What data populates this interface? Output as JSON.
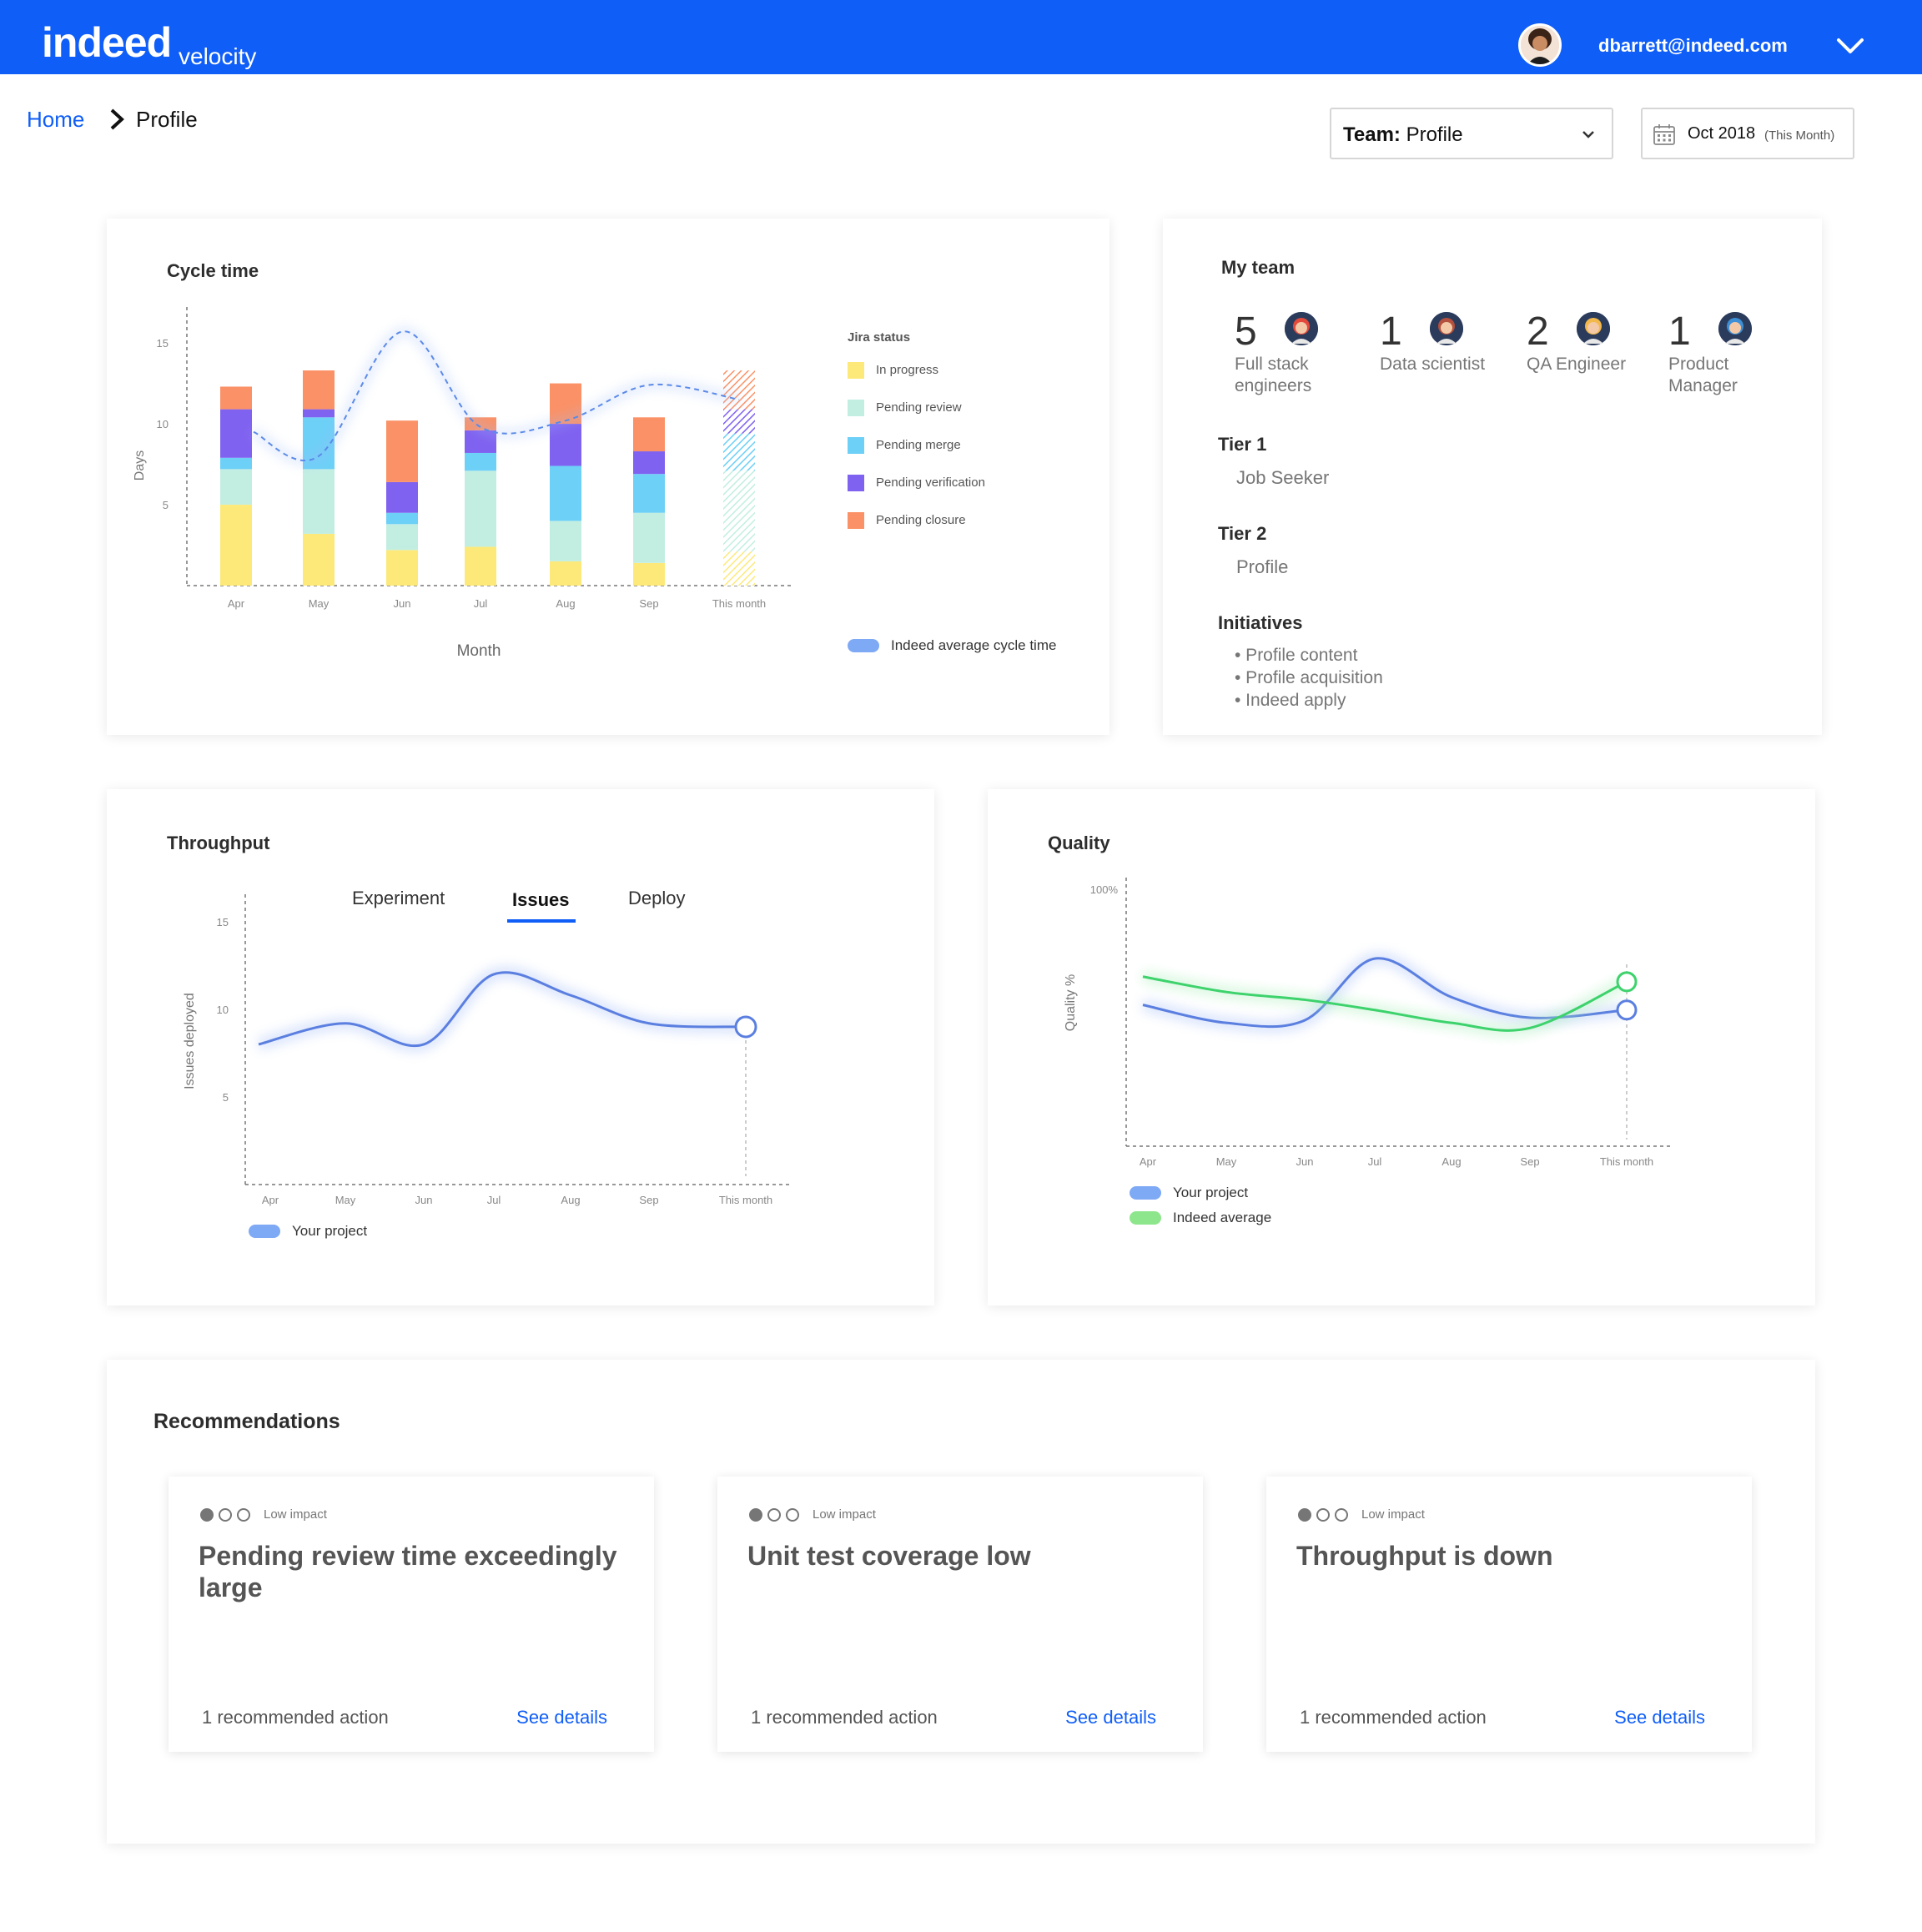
{
  "app": {
    "logo": "indeed",
    "logo_sub": "velocity",
    "user_email": "dbarrett@indeed.com"
  },
  "breadcrumb": {
    "home": "Home",
    "current": "Profile"
  },
  "filters": {
    "team_label": "Team:",
    "team_value": "Profile",
    "date_value": "Oct 2018",
    "date_note": "(This Month)"
  },
  "colors": {
    "brand": "#0f5ef7",
    "in_progress": "#fde97a",
    "pending_review": "#c2eee2",
    "pending_merge": "#6dd0f7",
    "pending_verification": "#8062f0",
    "pending_closure": "#fb9166",
    "your_project": "#5b7fe0",
    "indeed_average": "#3dd26c"
  },
  "cycle_time": {
    "title": "Cycle time",
    "legend_title": "Jira status",
    "legend": [
      {
        "label": "In progress",
        "color": "#fde97a"
      },
      {
        "label": "Pending review",
        "color": "#c2eee2"
      },
      {
        "label": "Pending merge",
        "color": "#6dd0f7"
      },
      {
        "label": "Pending verification",
        "color": "#8062f0"
      },
      {
        "label": "Pending closure",
        "color": "#fb9166"
      }
    ],
    "avg_legend": "Indeed average cycle time"
  },
  "my_team": {
    "title": "My team",
    "members": [
      {
        "count": "5",
        "role": "Full stack engineers",
        "avatar": "engineer-avatar-icon",
        "color": "#e44a3b"
      },
      {
        "count": "1",
        "role": "Data scientist",
        "avatar": "scientist-avatar-icon",
        "color": "#b4503d"
      },
      {
        "count": "2",
        "role": "QA Engineer",
        "avatar": "qa-avatar-icon",
        "color": "#f2b84a"
      },
      {
        "count": "1",
        "role": "Product Manager",
        "avatar": "pm-avatar-icon",
        "color": "#3d8fd6"
      }
    ],
    "tier1_label": "Tier 1",
    "tier1_value": "Job Seeker",
    "tier2_label": "Tier 2",
    "tier2_value": "Profile",
    "initiatives_label": "Initiatives",
    "initiatives": [
      "Profile content",
      "Profile acquisition",
      "Indeed apply"
    ]
  },
  "throughput": {
    "title": "Throughput",
    "tabs": [
      "Experiment",
      "Issues",
      "Deploy"
    ],
    "active_tab": "Issues",
    "legend": "Your project"
  },
  "quality": {
    "title": "Quality",
    "legend": [
      "Your project",
      "Indeed average"
    ]
  },
  "chart_data": [
    {
      "type": "bar",
      "stacked": true,
      "title": "Cycle time",
      "xlabel": "Month",
      "ylabel": "Days",
      "ylim": [
        0,
        16.5
      ],
      "yticks": [
        5,
        10,
        15
      ],
      "categories": [
        "Apr",
        "May",
        "Jun",
        "Jul",
        "Aug",
        "Sep",
        "This month"
      ],
      "series": [
        {
          "name": "In progress",
          "values": [
            5,
            3.2,
            2.2,
            2.4,
            1.5,
            1.4,
            2.1
          ]
        },
        {
          "name": "Pending review",
          "values": [
            2.2,
            4,
            1.6,
            4.7,
            2.5,
            3.1,
            5
          ]
        },
        {
          "name": "Pending merge",
          "values": [
            0.7,
            3.2,
            0.7,
            1.1,
            3.4,
            2.4,
            2.3
          ]
        },
        {
          "name": "Pending verification",
          "values": [
            3,
            0.5,
            1.9,
            1.4,
            2.6,
            1.4,
            1.5
          ]
        },
        {
          "name": "Pending closure",
          "values": [
            1.4,
            2.4,
            3.8,
            0.8,
            2.5,
            2.1,
            2.4
          ]
        }
      ],
      "average_line": {
        "name": "Indeed average cycle time",
        "values": [
          9.5,
          8,
          15.7,
          9.8,
          10.2,
          12.4,
          11.5
        ]
      }
    },
    {
      "type": "line",
      "title": "Throughput",
      "ylabel": "Issues deployed",
      "ylim": [
        0,
        15.9
      ],
      "yticks": [
        5,
        10,
        15
      ],
      "categories": [
        "Apr",
        "May",
        "Jun",
        "Jul",
        "Aug",
        "Sep",
        "This month"
      ],
      "series": [
        {
          "name": "Your project",
          "values": [
            8,
            9.2,
            8,
            12,
            10.8,
            9.2,
            9
          ]
        }
      ]
    },
    {
      "type": "line",
      "title": "Quality",
      "ylabel": "Quality %",
      "ylim": [
        0,
        100
      ],
      "yticks_labels": [
        "100%"
      ],
      "categories": [
        "Apr",
        "May",
        "Jun",
        "Jul",
        "Aug",
        "Sep",
        "This month"
      ],
      "series": [
        {
          "name": "Your project",
          "values": [
            55,
            48,
            49,
            73,
            58,
            50,
            53
          ]
        },
        {
          "name": "Indeed average",
          "values": [
            66,
            60,
            57,
            53,
            48,
            46,
            64
          ]
        }
      ]
    }
  ],
  "recommendations": {
    "title": "Recommendations",
    "items": [
      {
        "impact": "Low impact",
        "title": "Pending review time exceedingly large",
        "action": "1 recommended action",
        "link": "See details"
      },
      {
        "impact": "Low impact",
        "title": "Unit test coverage low",
        "action": "1 recommended action",
        "link": "See details"
      },
      {
        "impact": "Low impact",
        "title": "Throughput is down",
        "action": "1 recommended action",
        "link": "See details"
      }
    ]
  }
}
